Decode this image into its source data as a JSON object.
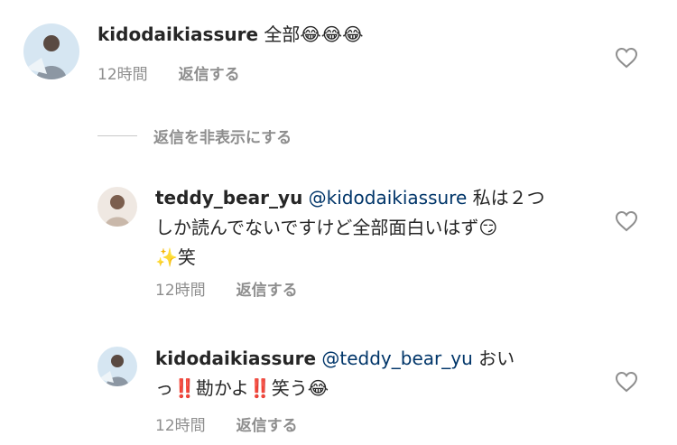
{
  "comments": [
    {
      "username": "kidodaikiassure",
      "mention": "",
      "text_lines": [
        "全部😂😂😂"
      ],
      "time": "12時間",
      "reply_label": "返信する"
    },
    {
      "username": "teddy_bear_yu",
      "mention": "@kidodaikiassure",
      "text_lines": [
        " 私は２つ",
        "しか読んでないですけど全部面白いはず😏",
        "✨笑"
      ],
      "time": "12時間",
      "reply_label": "返信する"
    },
    {
      "username": "kidodaikiassure",
      "mention": "@teddy_bear_yu",
      "text_lines": [
        " おい",
        "っ‼️勘かよ‼️笑う😂"
      ],
      "time": "12時間",
      "reply_label": "返信する"
    }
  ],
  "hide_replies_label": "返信を非表示にする",
  "icons": {
    "like": "heart-outline-icon"
  },
  "colors": {
    "text": "#262626",
    "secondary": "#8e8e8e",
    "mention": "#003569"
  }
}
